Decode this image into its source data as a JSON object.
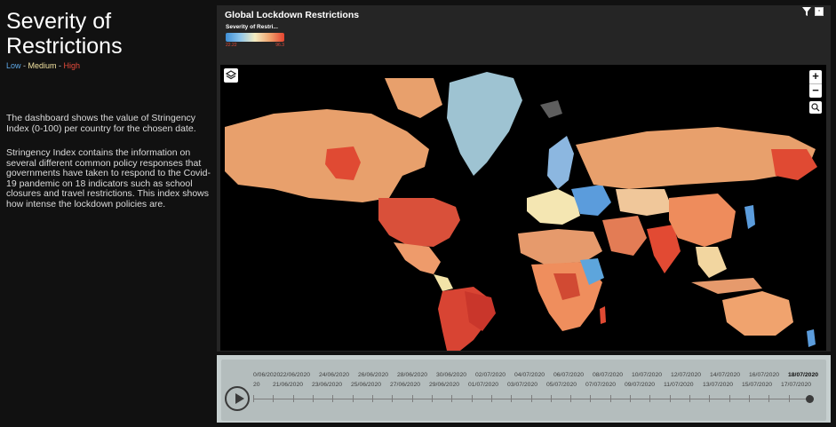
{
  "left": {
    "title": "Severity of Restrictions",
    "legend": {
      "low": "Low",
      "sep1": " - ",
      "medium": "Medium",
      "sep2": " - ",
      "high": "High"
    },
    "paragraph1": "The dashboard shows the value of Stringency Index (0-100) per country for the chosen date.",
    "paragraph2": "Stringency Index contains the information on several different common policy responses that governments have taken to respond to the Covid-19 pandemic on 18 indicators such as school closures and travel restrictions. This index shows how intense the lockdown policies are."
  },
  "panel": {
    "title": "Global Lockdown Restrictions",
    "legend_title": "Severity of Restri...",
    "legend_min": "22.22",
    "legend_max": "96.3",
    "colors": {
      "low": "#3e8fd6",
      "lowmid": "#8fc6ea",
      "mid": "#f4ecc1",
      "highmid": "#f0a36e",
      "high": "#e4432f"
    }
  },
  "map_controls": {
    "zoom_in": "+",
    "zoom_out": "−"
  },
  "timeline": {
    "row1": [
      "0/06/2020",
      "22/06/2020",
      "24/06/2020",
      "26/06/2020",
      "28/06/2020",
      "30/06/2020",
      "02/07/2020",
      "04/07/2020",
      "06/07/2020",
      "08/07/2020",
      "10/07/2020",
      "12/07/2020",
      "14/07/2020",
      "16/07/2020",
      "18/07/2020"
    ],
    "row2": [
      "20",
      "21/06/2020",
      "23/06/2020",
      "25/06/2020",
      "27/06/2020",
      "29/06/2020",
      "01/07/2020",
      "03/07/2020",
      "05/07/2020",
      "07/07/2020",
      "09/07/2020",
      "11/07/2020",
      "13/07/2020",
      "15/07/2020",
      "17/07/2020"
    ],
    "selected": "18/07/2020",
    "progress": 1.0
  }
}
